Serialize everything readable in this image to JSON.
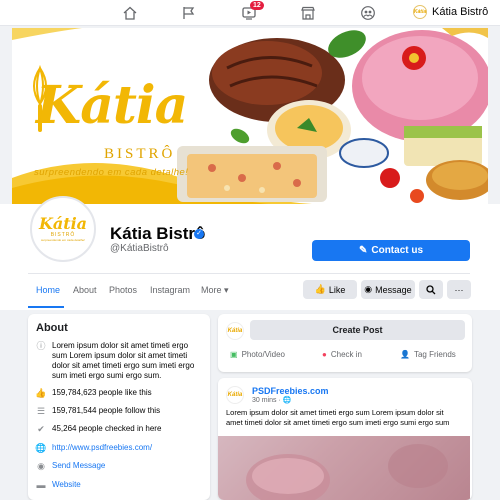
{
  "topnav": {
    "icons": [
      "home-icon",
      "flag-icon",
      "video-icon",
      "marketplace-icon",
      "groups-icon"
    ],
    "video_badge": "12",
    "profile_name": "Kátia Bistrô",
    "profile_avatar_text": "Kátia"
  },
  "cover": {
    "logo_main": "Kátia",
    "logo_sub": "BISTRÔ",
    "tagline": "surpreendendo em cada detalhe!"
  },
  "page": {
    "avatar_main": "Kátia",
    "avatar_sub": "BISTRÔ",
    "avatar_tag": "surpreendendo em cada detalhe!",
    "name": "Kátia Bistrô",
    "handle": "@KátiaBistrô",
    "contact_label": "Contact us"
  },
  "tabs": [
    "Home",
    "About",
    "Photos",
    "Instagram",
    "More"
  ],
  "actions": {
    "like": "Like",
    "message": "Message"
  },
  "about": {
    "title": "About",
    "description": "Lorem ipsum dolor sit amet timeti ergo sum Lorem ipsum dolor sit amet timeti dolor sit amet timeti ergo sum imeti ergo sum imeti ergo sumi ergo sum.",
    "likes": "159,784,623 people like this",
    "follows": "159,781,544 people follow this",
    "checkins": "45,264 people checked in here",
    "website_url": "http://www.psdfreebies.com/",
    "send_message": "Send Message",
    "website_label": "Website"
  },
  "create_post": {
    "avatar_text": "Kátia",
    "button": "Create Post",
    "photo_video": "Photo/Video",
    "check_in": "Check in",
    "tag_friends": "Tag Friends"
  },
  "post": {
    "avatar_text": "Kátia",
    "author": "PSDFreebies.com",
    "time": "30 mins",
    "text": "Lorem ipsum dolor sit amet timeti ergo sum Lorem ipsum dolor sit amet timeti dolor sit amet timeti ergo sum imeti ergo sumi ergo sum"
  },
  "colors": {
    "brand_blue": "#1877f2",
    "logo_gold": "#f2b705",
    "badge_red": "#e41e3f"
  }
}
